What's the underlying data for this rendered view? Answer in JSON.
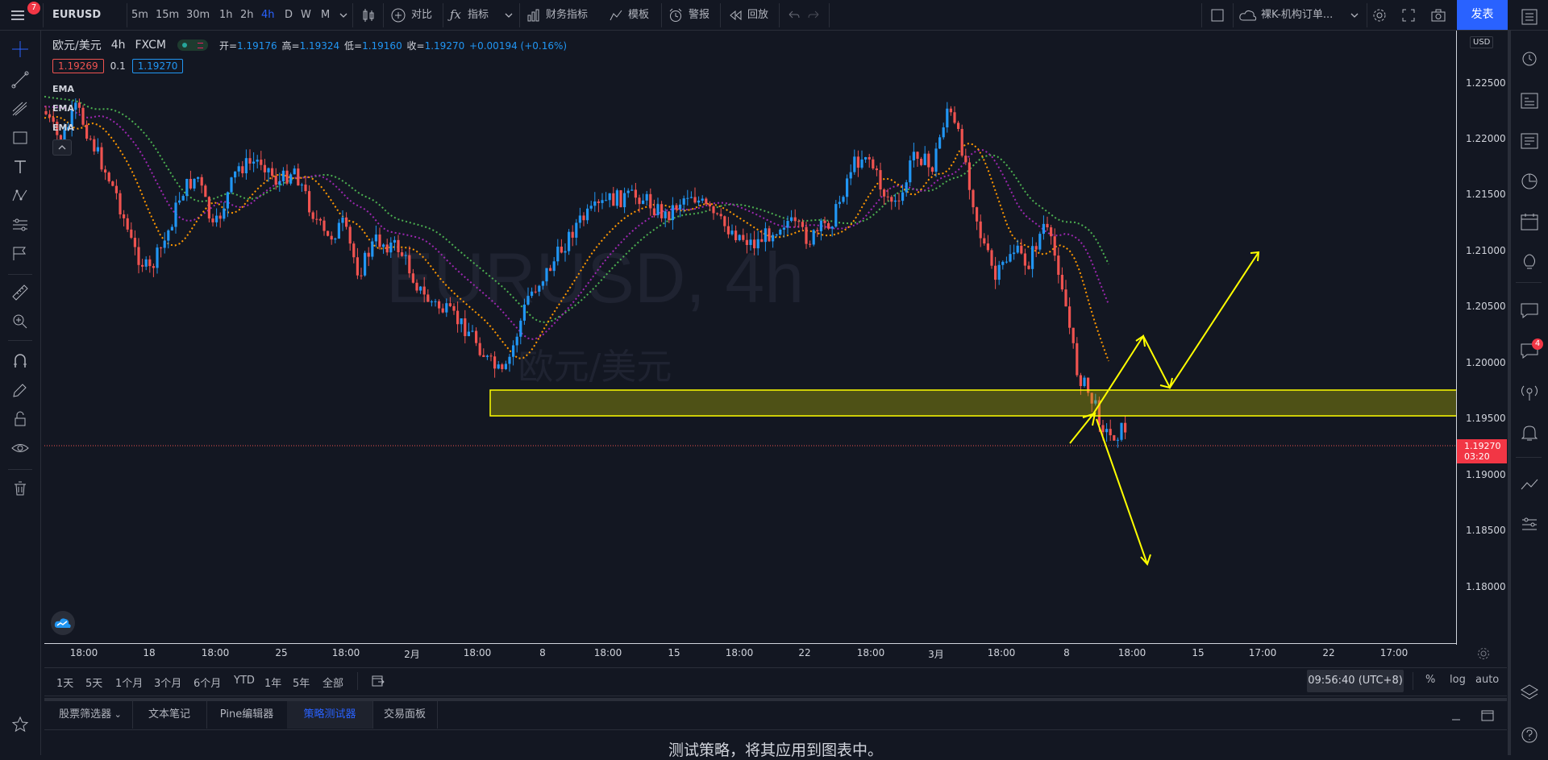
{
  "header": {
    "notif_count": "7",
    "symbol": "EURUSD",
    "intervals": [
      "5m",
      "15m",
      "30m",
      "1h",
      "2h",
      "4h",
      "D",
      "W",
      "M"
    ],
    "active_interval": "4h",
    "compare_label": "对比",
    "indicators_label": "指标",
    "financials_label": "财务指标",
    "templates_label": "模板",
    "alert_label": "警报",
    "replay_label": "回放",
    "layout_name": "裸K-机构订单...",
    "publish_label": "发表"
  },
  "legend": {
    "pair": "欧元/美元",
    "interval": "4h",
    "source": "FXCM",
    "open_label": "开=",
    "open": "1.19176",
    "high_label": "高=",
    "high": "1.19324",
    "low_label": "低=",
    "low": "1.19160",
    "close_label": "收=",
    "close": "1.19270",
    "change": "+0.00194 (+0.16%)",
    "bid": "1.19269",
    "spread": "0.1",
    "ask": "1.19270",
    "ema": [
      "EMA",
      "EMA",
      "EMA"
    ]
  },
  "watermark": {
    "symbol": "EURUSD, 4h",
    "name": "欧元/美元"
  },
  "price_axis": {
    "currency": "USD",
    "labels": [
      "1.22500",
      "1.22000",
      "1.21500",
      "1.21000",
      "1.20500",
      "1.20000",
      "1.19500",
      "1.19000",
      "1.18500",
      "1.18000"
    ],
    "current_price": "1.19270",
    "countdown": "03:20"
  },
  "time_axis": {
    "labels": [
      "18:00",
      "18",
      "18:00",
      "25",
      "18:00",
      "2月",
      "18:00",
      "8",
      "18:00",
      "15",
      "18:00",
      "22",
      "18:00",
      "3月",
      "18:00",
      "8",
      "18:00",
      "15",
      "17:00",
      "22",
      "17:00"
    ]
  },
  "ranges": {
    "items": [
      "1天",
      "5天",
      "1个月",
      "3个月",
      "6个月",
      "YTD",
      "1年",
      "5年",
      "全部"
    ],
    "clock": "09:56:40 (UTC+8)",
    "percent": "%",
    "log": "log",
    "auto": "auto"
  },
  "bottom_tabs": {
    "items": [
      "股票筛选器",
      "文本笔记",
      "Pine编辑器",
      "策略测试器",
      "交易面板"
    ],
    "active": "策略测试器",
    "message": "测试策略，将其应用到图表中。"
  },
  "right_badge": "4",
  "colors": {
    "up": "#2196f3",
    "down": "#ef5350",
    "ema_green": "#4caf50",
    "ema_purple": "#9c27b0",
    "ema_orange": "#ff9800",
    "zone": "#ffff00",
    "accent": "#2962ff"
  }
}
